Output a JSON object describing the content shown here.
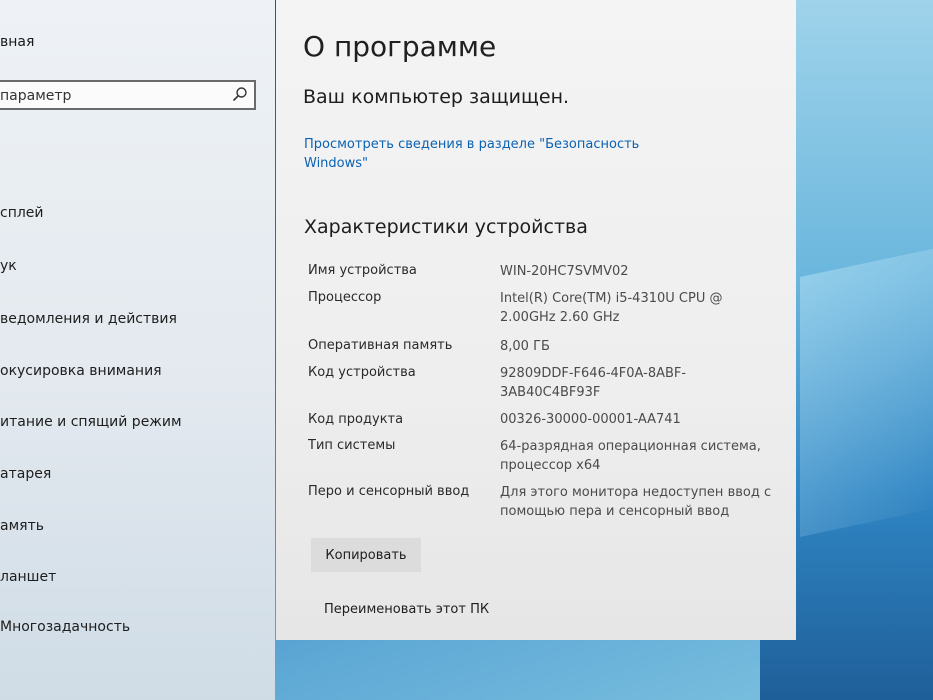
{
  "sidebar": {
    "home_label": "вная",
    "search_text": "параметр",
    "items": [
      {
        "label": "сплей"
      },
      {
        "label": "ук"
      },
      {
        "label": "ведомления и действия"
      },
      {
        "label": "окусировка внимания"
      },
      {
        "label": "итание и спящий режим"
      },
      {
        "label": "атарея"
      },
      {
        "label": "амять"
      },
      {
        "label": "ланшет"
      },
      {
        "label": "Многозадачность"
      }
    ]
  },
  "main": {
    "title": "О программе",
    "protected_text": "Ваш компьютер защищен.",
    "security_link": "Просмотреть сведения в разделе \"Безопасность Windows\"",
    "specs_title": "Характеристики устройства",
    "specs": [
      {
        "label": "Имя устройства",
        "value": "WIN-20HC7SVMV02"
      },
      {
        "label": "Процессор",
        "value": "Intel(R) Core(TM) i5-4310U CPU @ 2.00GHz   2.60 GHz"
      },
      {
        "label": "Оперативная память",
        "value": "8,00 ГБ"
      },
      {
        "label": "Код устройства",
        "value": "92809DDF-F646-4F0A-8ABF-3AB40C4BF93F"
      },
      {
        "label": "Код продукта",
        "value": "00326-30000-00001-AA741"
      },
      {
        "label": "Тип системы",
        "value": "64-разрядная операционная система, процессор x64"
      },
      {
        "label": "Перо и сенсорный ввод",
        "value": "Для этого монитора недоступен ввод с помощью пера и сенсорный ввод"
      }
    ],
    "copy_label": "Копировать",
    "rename_label": "Переименовать этот ПК"
  },
  "colors": {
    "link": "#0b62b3",
    "panel": "#f0f0f0",
    "wallpaper": "#2f78b8"
  }
}
